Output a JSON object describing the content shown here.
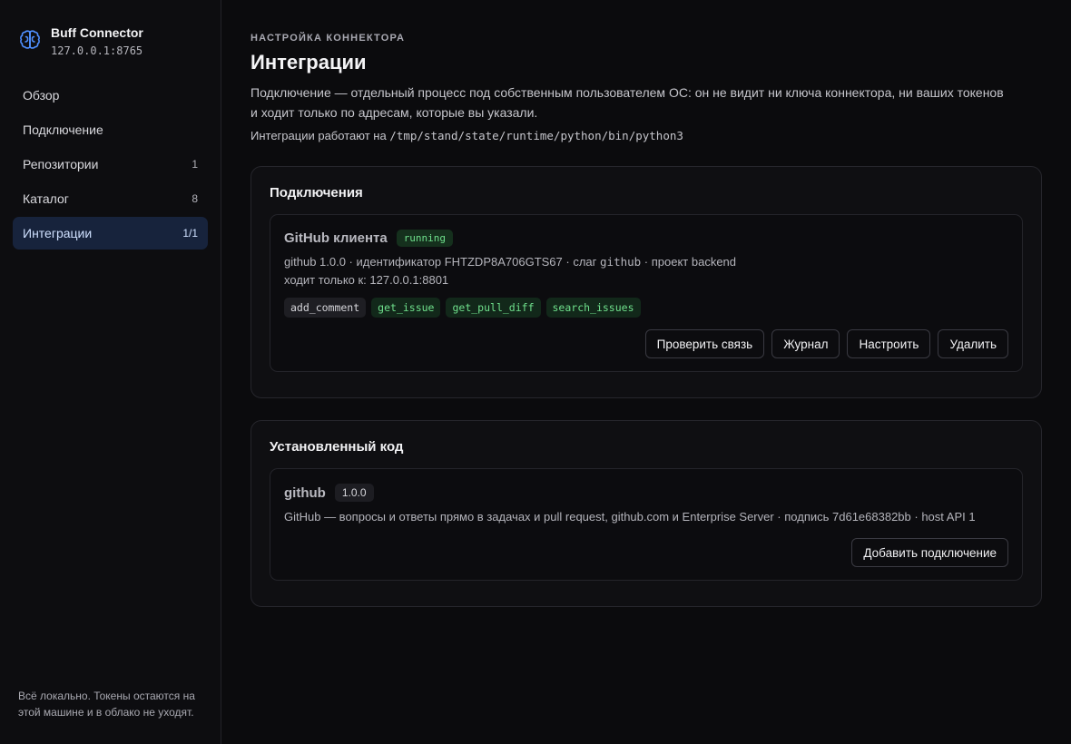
{
  "brand": {
    "name": "Buff Connector",
    "host": "127.0.0.1:8765"
  },
  "nav": [
    {
      "label": "Обзор",
      "count": ""
    },
    {
      "label": "Подключение",
      "count": ""
    },
    {
      "label": "Репозитории",
      "count": "1"
    },
    {
      "label": "Каталог",
      "count": "8"
    },
    {
      "label": "Интеграции",
      "count": "1/1"
    }
  ],
  "sidebar_footer": "Всё локально. Токены остаются на этой машине и в облако не уходят.",
  "header": {
    "eyebrow": "НАСТРОЙКА КОННЕКТОРА",
    "title": "Интеграции",
    "subtitle": "Подключение — отдельный процесс под собственным пользователем ОС: он не видит ни ключа коннектора, ни ваших токенов и ходит только по адресам, которые вы указали.",
    "runtime_prefix": "Интеграции работают на",
    "runtime_path": "/tmp/stand/state/runtime/python/bin/python3"
  },
  "connections": {
    "title": "Подключения",
    "item": {
      "name": "GitHub клиента",
      "status": "running",
      "meta_prefix": "github 1.0.0 · идентификатор FHTZDP8A706GTS67 · слаг",
      "slug": "github",
      "meta_suffix": "· проект backend",
      "allowed": "ходит только к: 127.0.0.1:8801",
      "tools": [
        {
          "name": "add_comment",
          "style": "plain"
        },
        {
          "name": "get_issue",
          "style": "green"
        },
        {
          "name": "get_pull_diff",
          "style": "green"
        },
        {
          "name": "search_issues",
          "style": "green"
        }
      ],
      "actions": {
        "check": "Проверить связь",
        "log": "Журнал",
        "configure": "Настроить",
        "delete": "Удалить"
      }
    }
  },
  "installed": {
    "title": "Установленный код",
    "item": {
      "name": "github",
      "version": "1.0.0",
      "description": "GitHub — вопросы и ответы прямо в задачах и pull request, github.com и Enterprise Server · подпись 7d61e68382bb · host API 1",
      "add_label": "Добавить подключение"
    }
  },
  "colors": {
    "accent": "#4f8fff",
    "active_nav_bg": "#17233c",
    "running_green": "#6fe08c"
  }
}
